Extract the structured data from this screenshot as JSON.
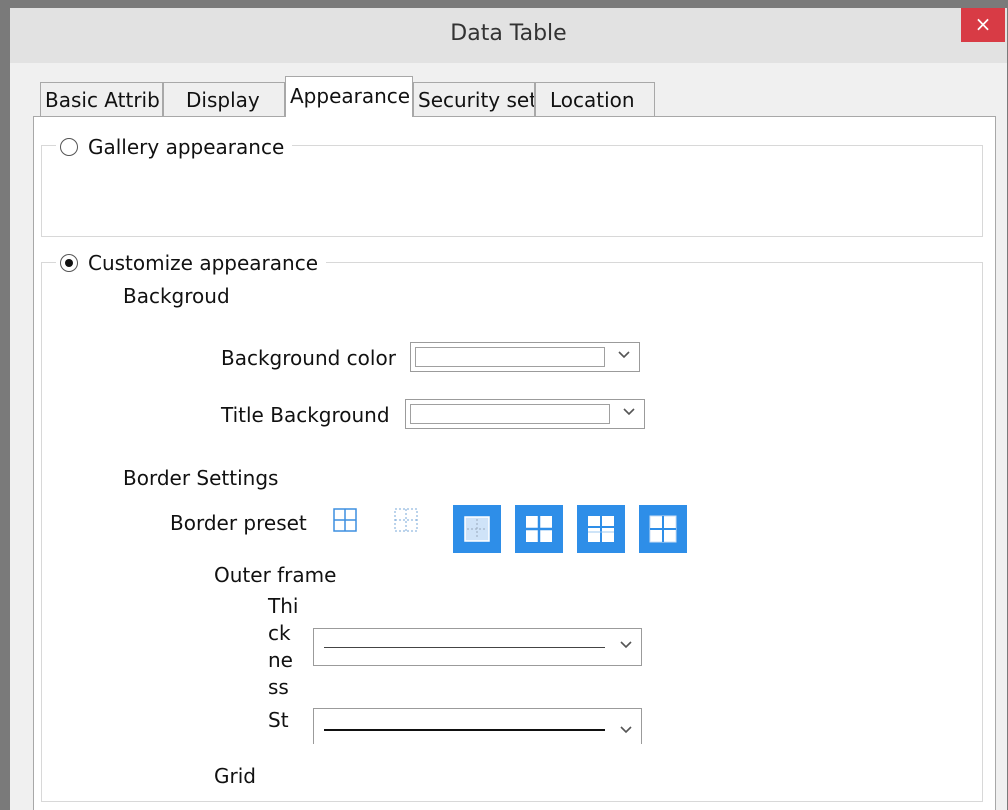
{
  "window": {
    "title": "Data Table",
    "close_label": "×"
  },
  "tabs": [
    {
      "label": "Basic Attrib",
      "active": false
    },
    {
      "label": "Display",
      "active": false
    },
    {
      "label": "Appearance",
      "active": true
    },
    {
      "label": "Security set",
      "active": false
    },
    {
      "label": "Location",
      "active": false
    }
  ],
  "gallery": {
    "label": "Gallery appearance",
    "selected": false
  },
  "customize": {
    "label": "Customize appearance",
    "selected": true,
    "background_heading": "Backgroud",
    "background_color_label": "Background color",
    "title_background_label": "Title Background",
    "border_heading": "Border Settings",
    "border_preset_label": "Border preset",
    "border_presets": [
      "all-borders",
      "inner-dotted",
      "inner-only",
      "grid-white",
      "grid-white-alt",
      "grid-white-outline"
    ],
    "outer_frame_label": "Outer frame",
    "thickness_label_lines": [
      "Thi",
      "ck",
      "ne",
      "ss"
    ],
    "style_label": "St",
    "grid_label": "Grid"
  },
  "colors": {
    "selected_preset": "#2e8ee8",
    "close_button": "#d83b45"
  }
}
